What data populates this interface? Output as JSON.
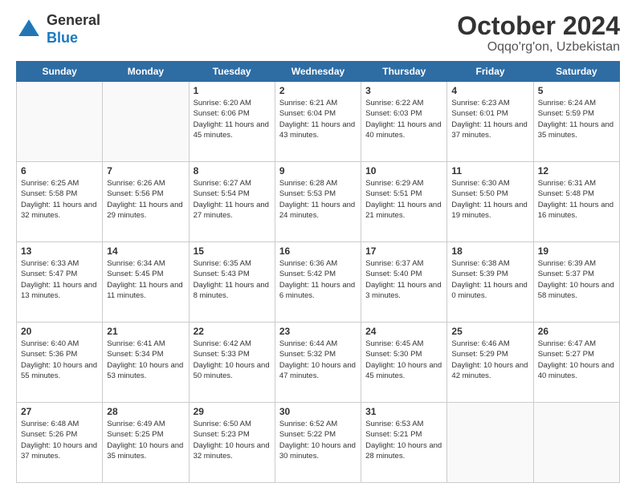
{
  "header": {
    "logo": {
      "line1": "General",
      "line2": "Blue"
    },
    "title": "October 2024",
    "location": "Oqqo'rg'on, Uzbekistan"
  },
  "days_of_week": [
    "Sunday",
    "Monday",
    "Tuesday",
    "Wednesday",
    "Thursday",
    "Friday",
    "Saturday"
  ],
  "weeks": [
    [
      {
        "day": "",
        "empty": true
      },
      {
        "day": "",
        "empty": true
      },
      {
        "day": "1",
        "sunrise": "Sunrise: 6:20 AM",
        "sunset": "Sunset: 6:06 PM",
        "daylight": "Daylight: 11 hours and 45 minutes."
      },
      {
        "day": "2",
        "sunrise": "Sunrise: 6:21 AM",
        "sunset": "Sunset: 6:04 PM",
        "daylight": "Daylight: 11 hours and 43 minutes."
      },
      {
        "day": "3",
        "sunrise": "Sunrise: 6:22 AM",
        "sunset": "Sunset: 6:03 PM",
        "daylight": "Daylight: 11 hours and 40 minutes."
      },
      {
        "day": "4",
        "sunrise": "Sunrise: 6:23 AM",
        "sunset": "Sunset: 6:01 PM",
        "daylight": "Daylight: 11 hours and 37 minutes."
      },
      {
        "day": "5",
        "sunrise": "Sunrise: 6:24 AM",
        "sunset": "Sunset: 5:59 PM",
        "daylight": "Daylight: 11 hours and 35 minutes."
      }
    ],
    [
      {
        "day": "6",
        "sunrise": "Sunrise: 6:25 AM",
        "sunset": "Sunset: 5:58 PM",
        "daylight": "Daylight: 11 hours and 32 minutes."
      },
      {
        "day": "7",
        "sunrise": "Sunrise: 6:26 AM",
        "sunset": "Sunset: 5:56 PM",
        "daylight": "Daylight: 11 hours and 29 minutes."
      },
      {
        "day": "8",
        "sunrise": "Sunrise: 6:27 AM",
        "sunset": "Sunset: 5:54 PM",
        "daylight": "Daylight: 11 hours and 27 minutes."
      },
      {
        "day": "9",
        "sunrise": "Sunrise: 6:28 AM",
        "sunset": "Sunset: 5:53 PM",
        "daylight": "Daylight: 11 hours and 24 minutes."
      },
      {
        "day": "10",
        "sunrise": "Sunrise: 6:29 AM",
        "sunset": "Sunset: 5:51 PM",
        "daylight": "Daylight: 11 hours and 21 minutes."
      },
      {
        "day": "11",
        "sunrise": "Sunrise: 6:30 AM",
        "sunset": "Sunset: 5:50 PM",
        "daylight": "Daylight: 11 hours and 19 minutes."
      },
      {
        "day": "12",
        "sunrise": "Sunrise: 6:31 AM",
        "sunset": "Sunset: 5:48 PM",
        "daylight": "Daylight: 11 hours and 16 minutes."
      }
    ],
    [
      {
        "day": "13",
        "sunrise": "Sunrise: 6:33 AM",
        "sunset": "Sunset: 5:47 PM",
        "daylight": "Daylight: 11 hours and 13 minutes."
      },
      {
        "day": "14",
        "sunrise": "Sunrise: 6:34 AM",
        "sunset": "Sunset: 5:45 PM",
        "daylight": "Daylight: 11 hours and 11 minutes."
      },
      {
        "day": "15",
        "sunrise": "Sunrise: 6:35 AM",
        "sunset": "Sunset: 5:43 PM",
        "daylight": "Daylight: 11 hours and 8 minutes."
      },
      {
        "day": "16",
        "sunrise": "Sunrise: 6:36 AM",
        "sunset": "Sunset: 5:42 PM",
        "daylight": "Daylight: 11 hours and 6 minutes."
      },
      {
        "day": "17",
        "sunrise": "Sunrise: 6:37 AM",
        "sunset": "Sunset: 5:40 PM",
        "daylight": "Daylight: 11 hours and 3 minutes."
      },
      {
        "day": "18",
        "sunrise": "Sunrise: 6:38 AM",
        "sunset": "Sunset: 5:39 PM",
        "daylight": "Daylight: 11 hours and 0 minutes."
      },
      {
        "day": "19",
        "sunrise": "Sunrise: 6:39 AM",
        "sunset": "Sunset: 5:37 PM",
        "daylight": "Daylight: 10 hours and 58 minutes."
      }
    ],
    [
      {
        "day": "20",
        "sunrise": "Sunrise: 6:40 AM",
        "sunset": "Sunset: 5:36 PM",
        "daylight": "Daylight: 10 hours and 55 minutes."
      },
      {
        "day": "21",
        "sunrise": "Sunrise: 6:41 AM",
        "sunset": "Sunset: 5:34 PM",
        "daylight": "Daylight: 10 hours and 53 minutes."
      },
      {
        "day": "22",
        "sunrise": "Sunrise: 6:42 AM",
        "sunset": "Sunset: 5:33 PM",
        "daylight": "Daylight: 10 hours and 50 minutes."
      },
      {
        "day": "23",
        "sunrise": "Sunrise: 6:44 AM",
        "sunset": "Sunset: 5:32 PM",
        "daylight": "Daylight: 10 hours and 47 minutes."
      },
      {
        "day": "24",
        "sunrise": "Sunrise: 6:45 AM",
        "sunset": "Sunset: 5:30 PM",
        "daylight": "Daylight: 10 hours and 45 minutes."
      },
      {
        "day": "25",
        "sunrise": "Sunrise: 6:46 AM",
        "sunset": "Sunset: 5:29 PM",
        "daylight": "Daylight: 10 hours and 42 minutes."
      },
      {
        "day": "26",
        "sunrise": "Sunrise: 6:47 AM",
        "sunset": "Sunset: 5:27 PM",
        "daylight": "Daylight: 10 hours and 40 minutes."
      }
    ],
    [
      {
        "day": "27",
        "sunrise": "Sunrise: 6:48 AM",
        "sunset": "Sunset: 5:26 PM",
        "daylight": "Daylight: 10 hours and 37 minutes."
      },
      {
        "day": "28",
        "sunrise": "Sunrise: 6:49 AM",
        "sunset": "Sunset: 5:25 PM",
        "daylight": "Daylight: 10 hours and 35 minutes."
      },
      {
        "day": "29",
        "sunrise": "Sunrise: 6:50 AM",
        "sunset": "Sunset: 5:23 PM",
        "daylight": "Daylight: 10 hours and 32 minutes."
      },
      {
        "day": "30",
        "sunrise": "Sunrise: 6:52 AM",
        "sunset": "Sunset: 5:22 PM",
        "daylight": "Daylight: 10 hours and 30 minutes."
      },
      {
        "day": "31",
        "sunrise": "Sunrise: 6:53 AM",
        "sunset": "Sunset: 5:21 PM",
        "daylight": "Daylight: 10 hours and 28 minutes."
      },
      {
        "day": "",
        "empty": true
      },
      {
        "day": "",
        "empty": true
      }
    ]
  ]
}
